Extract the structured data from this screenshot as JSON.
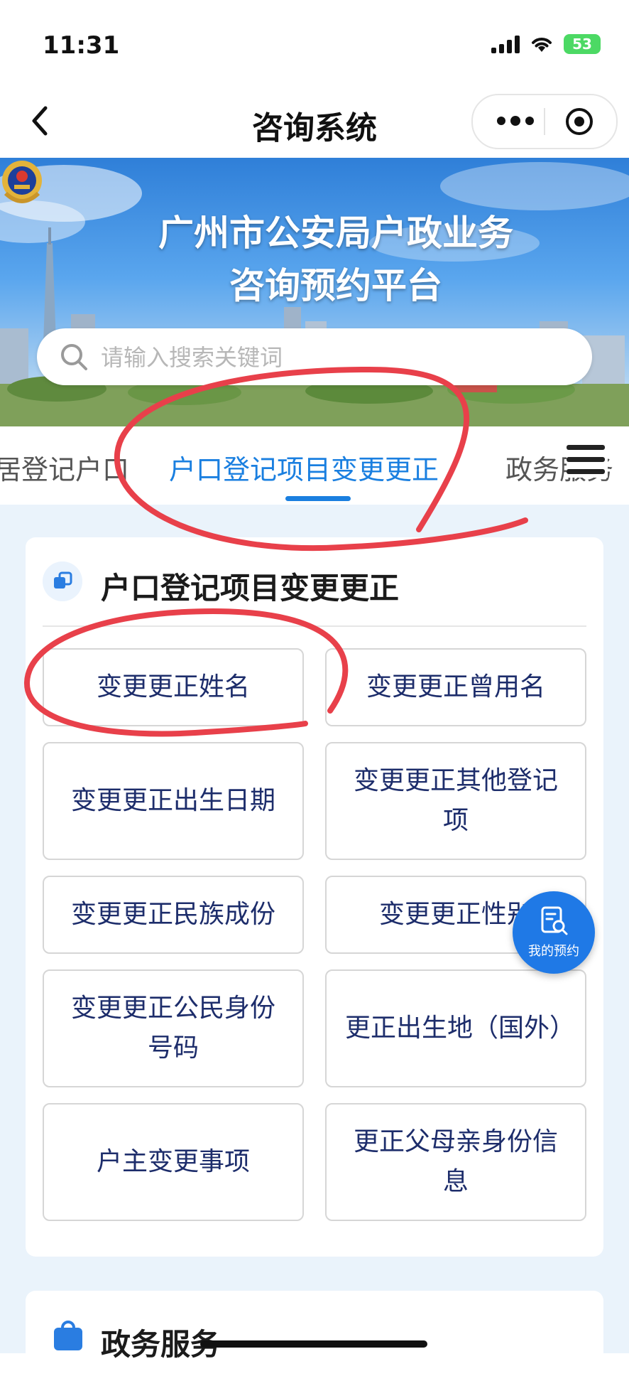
{
  "status_bar": {
    "time": "11:31",
    "battery": "53"
  },
  "nav": {
    "title": "咨询系统"
  },
  "banner": {
    "line1": "广州市公安局户政业务",
    "line2": "咨询预约平台"
  },
  "search": {
    "placeholder": "请输入搜索关键词",
    "value": ""
  },
  "tabs": [
    {
      "label": "居登记户口",
      "active": false
    },
    {
      "label": "户口登记项目变更更正",
      "active": true
    },
    {
      "label": "政务服务",
      "active": false
    }
  ],
  "section": {
    "title": "户口登记项目变更更正",
    "items": [
      "变更更正姓名",
      "变更更正曾用名",
      "变更更正出生日期",
      "变更更正其他登记项",
      "变更更正民族成份",
      "变更更正性别",
      "变更更正公民身份号码",
      "更正出生地（国外）",
      "户主变更事项",
      "更正父母亲身份信息"
    ]
  },
  "section2": {
    "title": "政务服务"
  },
  "float_button": {
    "label": "我的预约"
  },
  "colors": {
    "accent": "#1a7fe0",
    "annotation": "#e8404a",
    "item_text": "#1d2d6b",
    "page_bg": "#eaf3fb"
  }
}
